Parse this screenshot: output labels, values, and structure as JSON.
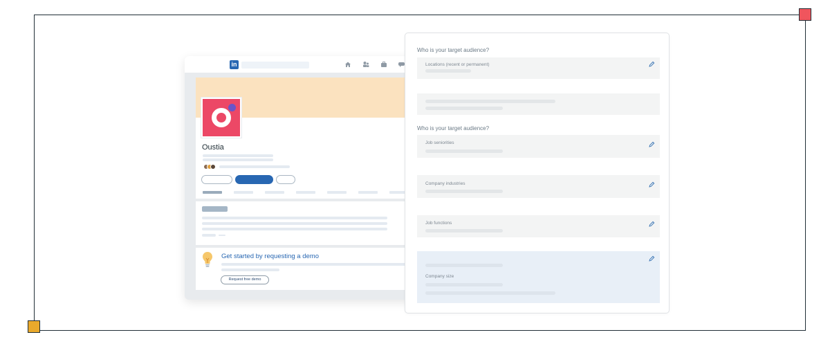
{
  "frame": {
    "border_color": "#1f2d35",
    "corner_top_right_color": "#f0555d",
    "corner_bottom_left_color": "#e9a92c"
  },
  "linkedin_mock": {
    "logo_text": "in",
    "brand_color": "#2867b2",
    "nav_icons": [
      "home-icon",
      "people-icon",
      "briefcase-icon",
      "chat-icon"
    ],
    "company_name": "Oustia",
    "banner_color": "#fbe2bf",
    "logo_color": "#ec4866",
    "demo_card": {
      "title": "Get started by requesting a demo",
      "button_label": "Request free demo",
      "icon": "lightbulb-icon"
    }
  },
  "form": {
    "questions": [
      "Who is your target audience?",
      "Who is your target audience?"
    ],
    "fields": {
      "locations": "Locations (recent or permanent)",
      "job_seniorities": "Job seniorities",
      "company_industries": "Company industries",
      "job_functions": "Job functions",
      "company_size": "Company size"
    },
    "edit_icon": "pencil-icon",
    "highlight_color": "#e8eff7"
  }
}
